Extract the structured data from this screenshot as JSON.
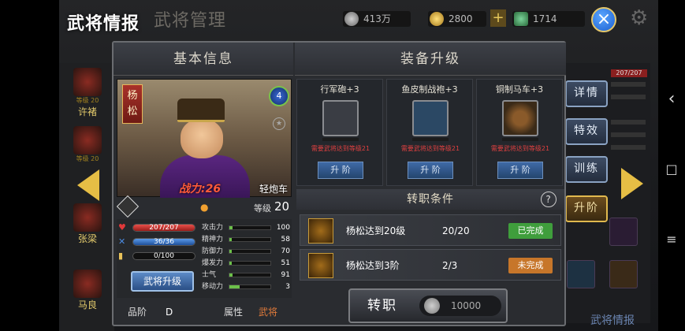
{
  "header": {
    "title_main": "武将情报",
    "title_sub": "武将管理"
  },
  "resources": [
    {
      "name": "silver",
      "value": "413万",
      "color": "#9a9a9a"
    },
    {
      "name": "gold",
      "value": "2800",
      "color": "#e0b23a"
    },
    {
      "name": "jade",
      "value": "1714",
      "color": "#3a9a5a"
    }
  ],
  "plus_label": "+",
  "close_label": "×",
  "gear_label": "⚙",
  "background": {
    "characters": [
      {
        "level": "等级 20",
        "name": "许褚"
      },
      {
        "level": "等级 20",
        "name": ""
      },
      {
        "level": "",
        "name": "张梁"
      },
      {
        "level": "",
        "name": "马良"
      }
    ],
    "side_hp": "207/207",
    "side_bottom_label": "武将情报"
  },
  "side_buttons": [
    {
      "label": "详情"
    },
    {
      "label": "特效"
    },
    {
      "label": "训练"
    },
    {
      "label": "升阶"
    }
  ],
  "left_panel": {
    "header": "基本信息",
    "name": "杨松",
    "star_level": "4",
    "power_label": "战力:26",
    "unit_type": "轻炮车",
    "level_label": "等级",
    "level_value": "20",
    "hp_text": "207/207",
    "hp_ratio": 1.0,
    "mp_text": "36/36",
    "mp_ratio": 1.0,
    "exp_text": "0/100",
    "exp_ratio": 0.0,
    "upgrade_btn": "武将升级",
    "attributes": [
      {
        "key": "攻击力",
        "value": "100",
        "ratio": 0.08
      },
      {
        "key": "精神力",
        "value": "58",
        "ratio": 0.06
      },
      {
        "key": "防御力",
        "value": "70",
        "ratio": 0.06
      },
      {
        "key": "爆发力",
        "value": "51",
        "ratio": 0.05
      },
      {
        "key": "士气",
        "value": "91",
        "ratio": 0.08
      },
      {
        "key": "移动力",
        "value": "3",
        "ratio": 0.25
      }
    ],
    "quality_label": "品阶",
    "quality_value": "D",
    "attr_label": "属性",
    "attr_value": "武将"
  },
  "equipment_panel": {
    "header": "装备升级",
    "items": [
      {
        "title": "行军砲+3",
        "need": "需要武将达到等级21",
        "button": "升 阶"
      },
      {
        "title": "鱼皮制战袍+3",
        "need": "需要武将达到等级21",
        "button": "升 阶"
      },
      {
        "title": "铜制马车+3",
        "need": "需要武将达到等级21",
        "button": "升 阶"
      }
    ]
  },
  "transfer": {
    "header": "转职条件",
    "help_label": "?",
    "conditions": [
      {
        "text": "杨松达到20级",
        "value": "20/20",
        "status": "已完成",
        "color": "#3f9e3c"
      },
      {
        "text": "杨松达到3阶",
        "value": "2/3",
        "status": "未完成",
        "color": "#c7762a"
      }
    ],
    "button_label": "转职",
    "cost": "10000"
  },
  "navbar": {
    "back": "‹",
    "home": "□",
    "menu": "≡"
  }
}
